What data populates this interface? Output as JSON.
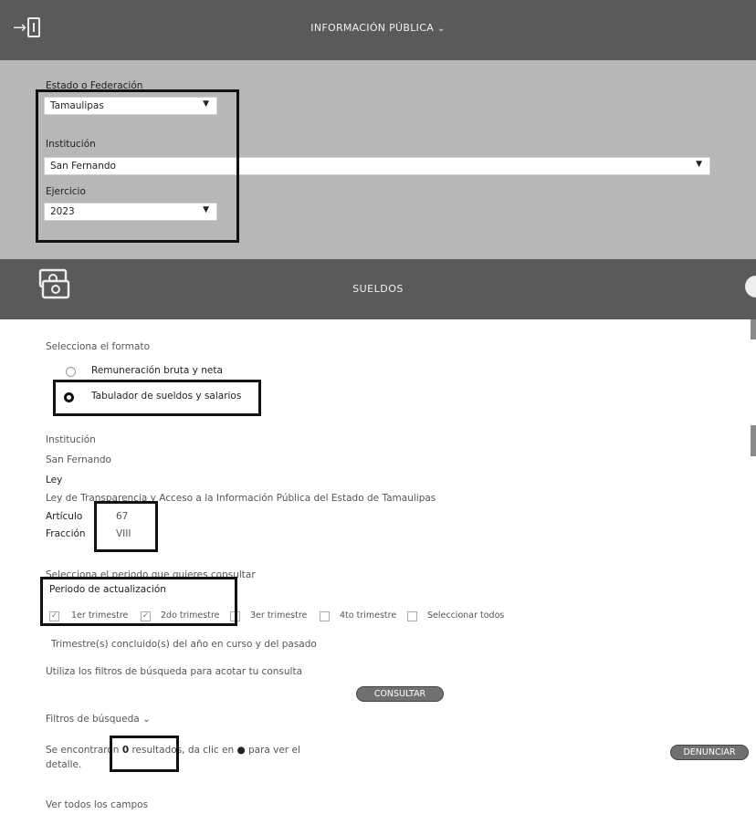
{
  "header": {
    "title": "INFORMACIÓN PÚBLICA",
    "chevron_icon": "chevron-down-icon",
    "login_icon": "sign-in-icon"
  },
  "filters": {
    "estado_label": "Estado o Federación",
    "estado_value": "Tamaulipas",
    "institucion_label": "Institución",
    "institucion_value": "San Fernando",
    "ejercicio_label": "Ejercicio",
    "ejercicio_value": "2023"
  },
  "section": {
    "title": "SUELDOS",
    "icon": "money-bills-icon",
    "share_icon": "share-icon"
  },
  "form": {
    "format_label": "Selecciona el formato",
    "radio_options": [
      "Remuneración bruta y neta",
      "Tabulador de sueldos y salarios"
    ],
    "selected_option_index": 1,
    "institucion_label": "Institución",
    "institucion_value": "San Fernando",
    "ley_label": "Ley",
    "ley_value": "Ley de Transparencia y Acceso a la Información Pública del Estado de Tamaulipas",
    "articulo_label": "Artículo",
    "articulo_value": "67",
    "fraccion_label": "Fracción",
    "fraccion_value": "VIII",
    "periodo_prompt": "Selecciona el periodo que quieres consultar",
    "periodo_label": "Periodo de actualización",
    "quarters": [
      {
        "label": "1er trimestre",
        "checked": true
      },
      {
        "label": "2do trimestre",
        "checked": true
      },
      {
        "label": "3er trimestre",
        "checked": false
      },
      {
        "label": "4to trimestre",
        "checked": false
      },
      {
        "label": "Seleccionar todos",
        "checked": false
      }
    ],
    "quarters_note": "Trimestre(s) concluido(s) del año en curso y del pasado",
    "filter_hint": "Utiliza los filtros de búsqueda para acotar tu consulta",
    "consultar_label": "CONSULTAR",
    "filtros_label": "Filtros de búsqueda",
    "results_pre": "Se encontraron",
    "results_count": "0",
    "results_mid": "resultados, da clic en",
    "results_post": "para ver el",
    "results_line2": "detalle.",
    "info_icon": "info-circle-icon",
    "denunciar_label": "DENUNCIAR",
    "ver_todos": "Ver todos los campos"
  }
}
